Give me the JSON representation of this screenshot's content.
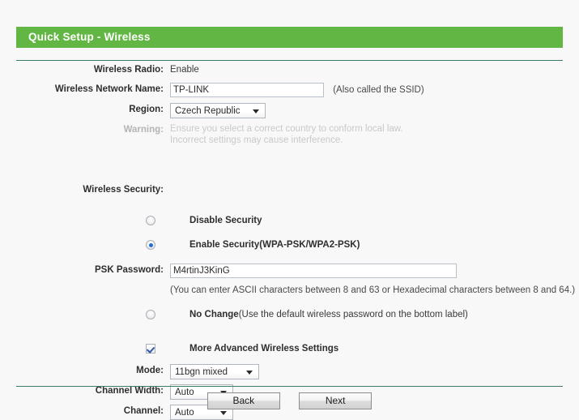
{
  "page": {
    "title": "Quick Setup - Wireless",
    "accent_color": "#62b744",
    "rule_color": "#3d7d63",
    "background_color": "#f8f8f8"
  },
  "fields": {
    "wireless_radio": {
      "label": "Wireless Radio:",
      "value": "Enable"
    },
    "network_name": {
      "label": "Wireless Network Name:",
      "value": "TP-LINK",
      "suffix": "(Also called the SSID)"
    },
    "region": {
      "label": "Region:",
      "value": "Czech Republic"
    },
    "warning": {
      "label": "Warning:",
      "line1": "Ensure you select a correct country to conform local law.",
      "line2": "Incorrect settings may cause interference."
    },
    "wireless_security": {
      "label": "Wireless Security:"
    },
    "disable_security": {
      "label": "Disable Security",
      "checked": false
    },
    "enable_security": {
      "label": "Enable Security(WPA-PSK/WPA2-PSK)",
      "checked": true
    },
    "psk_password": {
      "label": "PSK Password:",
      "value": "M4rtinJ3KinG",
      "hint": "(You can enter ASCII characters between 8 and 63 or Hexadecimal characters between 8 and 64.)"
    },
    "no_change": {
      "label_bold": "No Change",
      "label_normal": "(Use the default wireless password on the bottom label)",
      "checked": false
    },
    "more_advanced": {
      "label": "More Advanced Wireless Settings",
      "checked": true
    },
    "mode": {
      "label": "Mode:",
      "value": "11bgn mixed"
    },
    "channel_width": {
      "label": "Channel Width:",
      "value": "Auto"
    },
    "channel": {
      "label": "Channel:",
      "value": "Auto"
    }
  },
  "buttons": {
    "back": "Back",
    "next": "Next"
  }
}
